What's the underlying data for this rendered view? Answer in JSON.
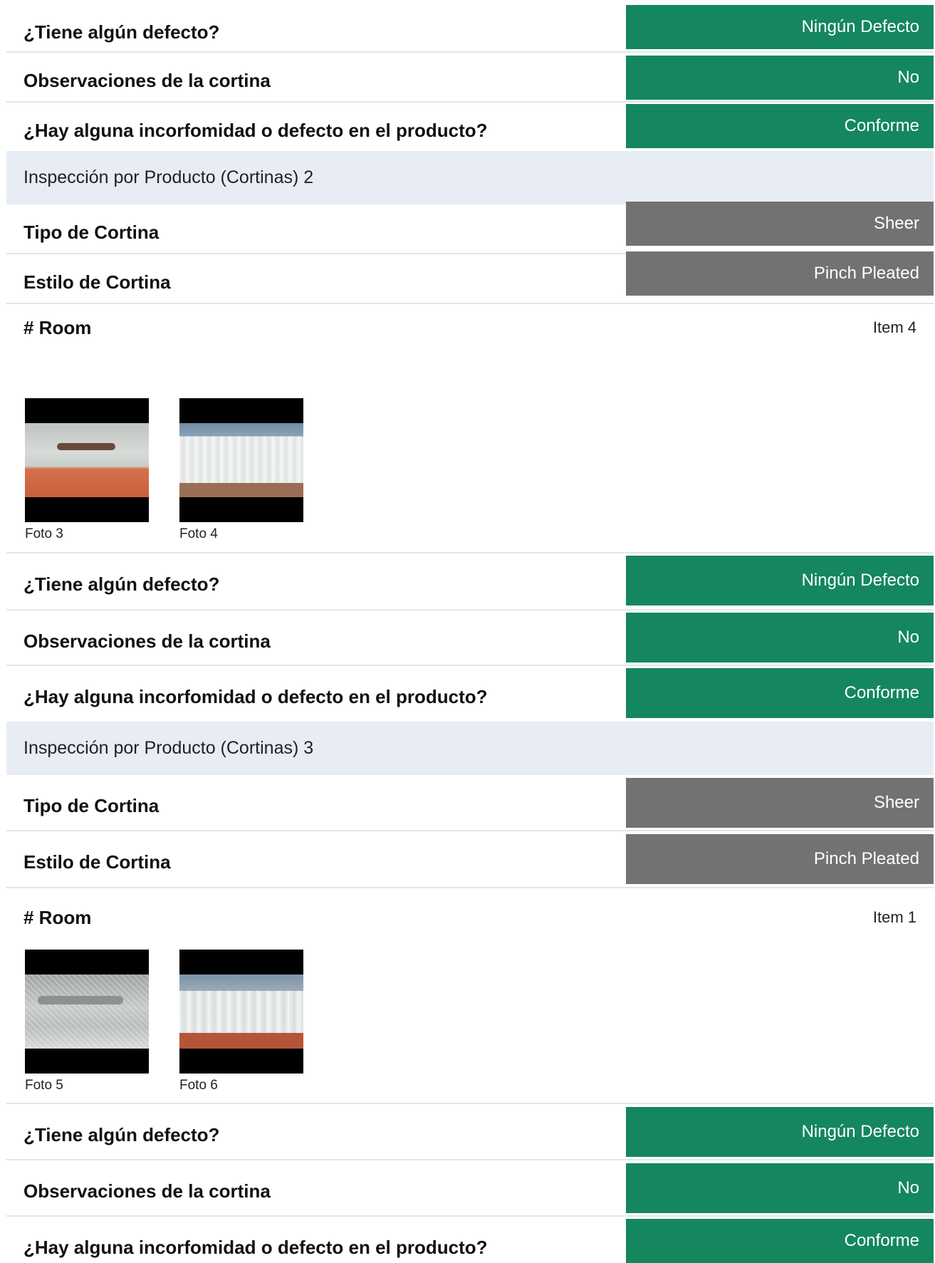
{
  "labels": {
    "defect_question": "¿Tiene algún defecto?",
    "observations": "Observaciones de la cortina",
    "conformity_question": "¿Hay alguna incorfomidad o defecto en el producto?",
    "curtain_type": "Tipo de Cortina",
    "curtain_style": "Estilo de Cortina",
    "room": "# Room"
  },
  "top_block": {
    "defect_value": "Ningún Defecto",
    "observations_value": "No",
    "conformity_value": "Conforme"
  },
  "inspections": [
    {
      "title": "Inspección por Producto (Cortinas) 2",
      "curtain_type": "Sheer",
      "curtain_style": "Pinch Pleated",
      "room": "Item 4",
      "photos": [
        "Foto 3",
        "Foto 4"
      ],
      "defect_value": "Ningún Defecto",
      "observations_value": "No",
      "conformity_value": "Conforme"
    },
    {
      "title": "Inspección por Producto (Cortinas) 3",
      "curtain_type": "Sheer",
      "curtain_style": "Pinch Pleated",
      "room": "Item 1",
      "photos": [
        "Foto 5",
        "Foto 6"
      ],
      "defect_value": "Ningún Defecto",
      "observations_value": "No",
      "conformity_value": "Conforme"
    }
  ],
  "colors": {
    "green_pill": "#14875e",
    "gray_pill": "#727272",
    "section_header_bg": "#e7ecf5"
  }
}
